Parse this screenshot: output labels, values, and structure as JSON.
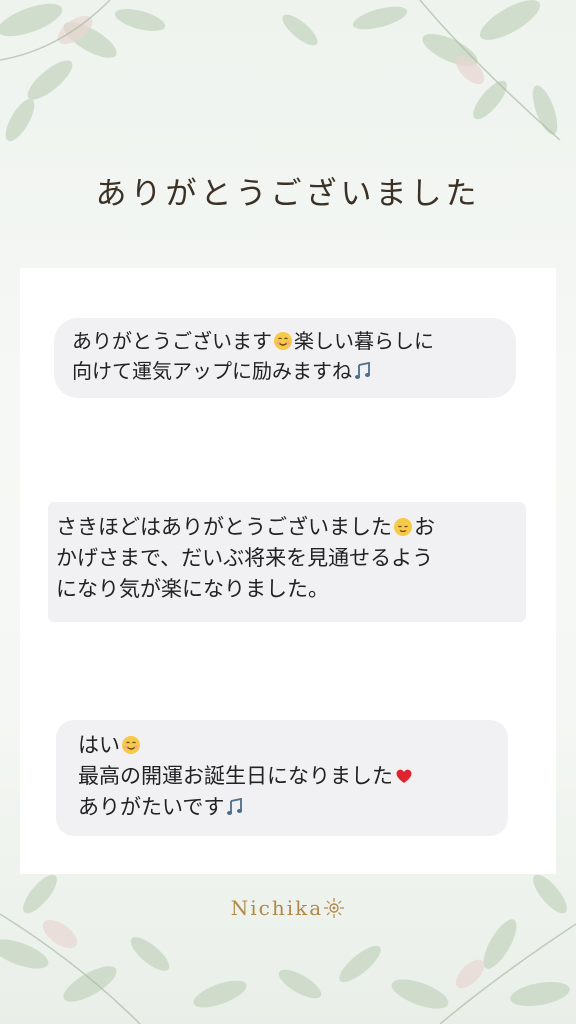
{
  "title": "ありがとうございました",
  "colors": {
    "accent": "#b0894a",
    "bubble": "#f1f1f3",
    "leaf": "#b9cbb6"
  },
  "messages": [
    {
      "line1_a": "ありがとうございます",
      "line1_emoji": "smiling-face-icon",
      "line1_b": "楽しい暮らしに",
      "line2_a": "向けて運気アップに励みますね",
      "line2_emoji": "music-note-icon"
    },
    {
      "line1_a": "さきほどはありがとうございました",
      "line1_emoji": "relieved-face-icon",
      "line1_b": "お",
      "line2": "かげさまで、だいぶ将来を見通せるよう",
      "line3": "になり気が楽になりました。"
    },
    {
      "line1_a": "はい",
      "line1_emoji": "smiling-face-icon",
      "line2_a": "最高の開運お誕生日になりました",
      "line2_emoji": "heart-icon",
      "line3_a": "ありがたいです",
      "line3_emoji": "music-note-icon"
    }
  ],
  "footer": {
    "brand": "Nichika",
    "icon": "sun-icon"
  }
}
